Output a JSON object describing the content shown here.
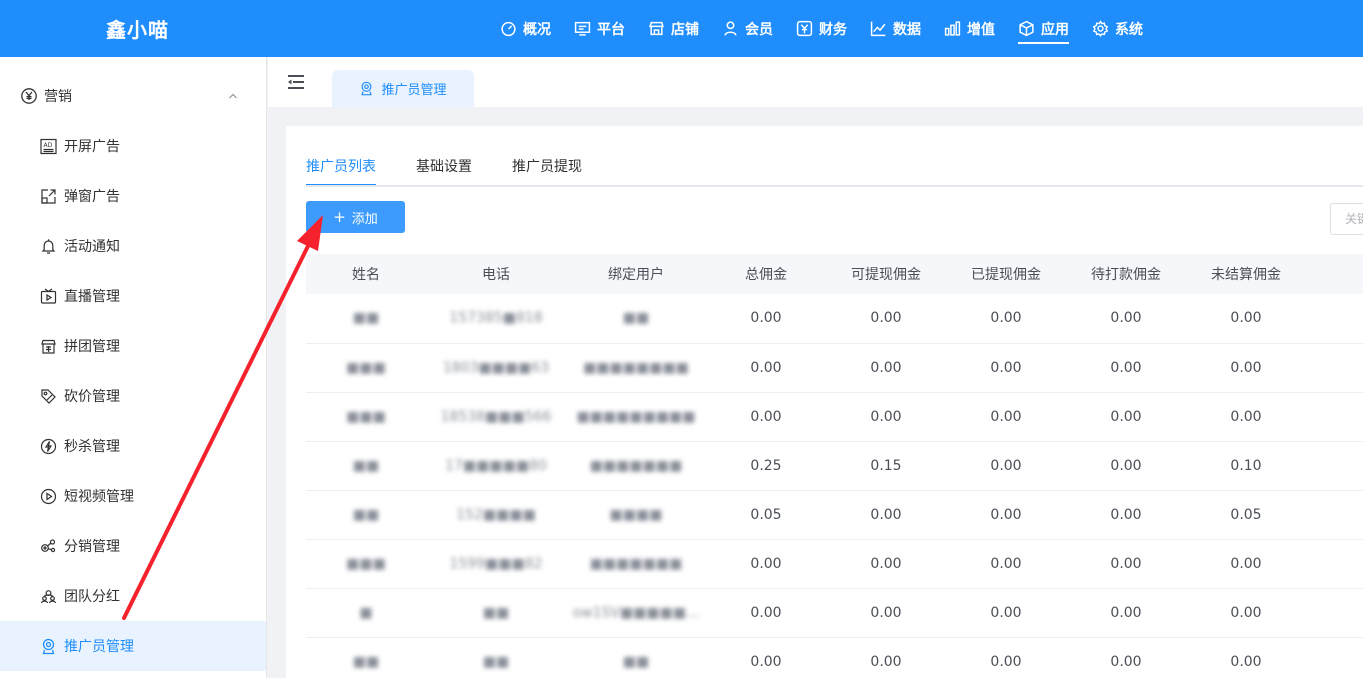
{
  "brand": "鑫小喵",
  "top_nav": [
    {
      "label": "概况",
      "icon": "dashboard-icon"
    },
    {
      "label": "平台",
      "icon": "monitor-icon"
    },
    {
      "label": "店铺",
      "icon": "store-icon"
    },
    {
      "label": "会员",
      "icon": "user-icon"
    },
    {
      "label": "财务",
      "icon": "yen-icon"
    },
    {
      "label": "数据",
      "icon": "line-chart-icon"
    },
    {
      "label": "增值",
      "icon": "bar-chart-icon"
    },
    {
      "label": "应用",
      "icon": "cube-icon",
      "active": true
    },
    {
      "label": "系统",
      "icon": "gear-icon"
    }
  ],
  "sidebar": {
    "group": {
      "label": "营销",
      "icon": "yen-circle-icon"
    },
    "items": [
      {
        "label": "开屏广告",
        "icon": "ad-icon"
      },
      {
        "label": "弹窗广告",
        "icon": "popup-icon"
      },
      {
        "label": "活动通知",
        "icon": "bell-icon"
      },
      {
        "label": "直播管理",
        "icon": "tv-icon"
      },
      {
        "label": "拼团管理",
        "icon": "group-buy-icon"
      },
      {
        "label": "砍价管理",
        "icon": "tag-icon"
      },
      {
        "label": "秒杀管理",
        "icon": "flash-icon"
      },
      {
        "label": "短视频管理",
        "icon": "play-icon"
      },
      {
        "label": "分销管理",
        "icon": "distribution-icon"
      },
      {
        "label": "团队分红",
        "icon": "team-icon"
      },
      {
        "label": "推广员管理",
        "icon": "promoter-icon",
        "active": true
      }
    ]
  },
  "page_tab": {
    "label": "推广员管理"
  },
  "sub_tabs": [
    {
      "label": "推广员列表",
      "active": true
    },
    {
      "label": "基础设置"
    },
    {
      "label": "推广员提现"
    }
  ],
  "add_button": {
    "label": "添加"
  },
  "right_button": {
    "label": "关键"
  },
  "table": {
    "headers": [
      "姓名",
      "电话",
      "绑定用户",
      "总佣金",
      "可提现佣金",
      "已提现佣金",
      "待打款佣金",
      "未结算佣金"
    ],
    "rows": [
      [
        "■■",
        "157385■818",
        "■■",
        "0.00",
        "0.00",
        "0.00",
        "0.00",
        "0.00"
      ],
      [
        "■■■",
        "1803■■■■63",
        "■■■■■■■■",
        "0.00",
        "0.00",
        "0.00",
        "0.00",
        "0.00"
      ],
      [
        "■■■",
        "18538■■■566",
        "■■■■■■■■■",
        "0.00",
        "0.00",
        "0.00",
        "0.00",
        "0.00"
      ],
      [
        "■■",
        "17■■■■■80",
        "■■■■■■■",
        "0.25",
        "0.15",
        "0.00",
        "0.00",
        "0.10"
      ],
      [
        "■■",
        "152■■■■",
        "■■■■",
        "0.05",
        "0.00",
        "0.00",
        "0.00",
        "0.05"
      ],
      [
        "■■■",
        "1599■■■82",
        "■■■■■■■",
        "0.00",
        "0.00",
        "0.00",
        "0.00",
        "0.00"
      ],
      [
        "■",
        "■■",
        "ow1SV■■■■■...",
        "0.00",
        "0.00",
        "0.00",
        "0.00",
        "0.00"
      ],
      [
        "■■",
        "■■",
        "■■",
        "0.00",
        "0.00",
        "0.00",
        "0.00",
        "0.00"
      ]
    ]
  },
  "colors": {
    "primary": "#1f8dfc",
    "annotation_arrow": "#f5222d"
  }
}
